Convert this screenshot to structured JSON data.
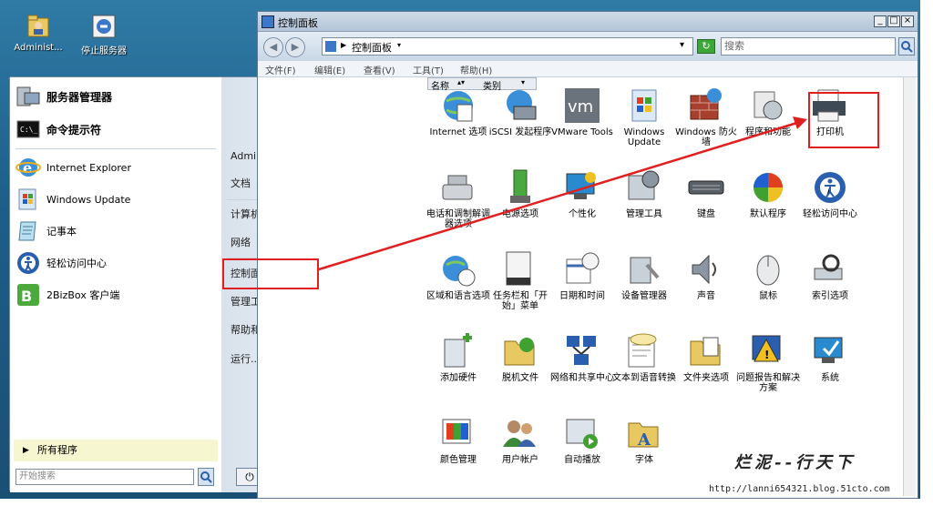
{
  "desktop": {
    "icons": [
      {
        "label": "Administ...",
        "icon": "user-folder-icon"
      },
      {
        "label": "停止服务器",
        "icon": "stop-server-icon"
      }
    ]
  },
  "start_menu": {
    "pinned": [
      {
        "label": "服务器管理器",
        "icon": "server-manager-icon",
        "bold": true
      },
      {
        "label": "命令提示符",
        "icon": "cmd-icon",
        "bold": true
      },
      {
        "label": "Internet Explorer",
        "icon": "ie-icon"
      },
      {
        "label": "Windows Update",
        "icon": "windows-update-icon"
      },
      {
        "label": "记事本",
        "icon": "notepad-icon"
      },
      {
        "label": "轻松访问中心",
        "icon": "ease-of-access-icon"
      },
      {
        "label": "2BizBox 客户端",
        "icon": "bizbox-icon"
      }
    ],
    "all_programs": "所有程序",
    "search_placeholder": "开始搜索",
    "right_items": [
      {
        "label": "Administrator"
      },
      {
        "label": "文档"
      },
      {
        "label": "计算机"
      },
      {
        "label": "网络"
      },
      {
        "label": "控制面板"
      },
      {
        "label": "管理工具"
      },
      {
        "label": "帮助和支持"
      },
      {
        "label": "运行..."
      }
    ]
  },
  "window": {
    "title": "控制面板",
    "address": "控制面板",
    "search_placeholder": "搜索",
    "menus": [
      "文件(F)",
      "编辑(E)",
      "查看(V)",
      "工具(T)",
      "帮助(H)"
    ],
    "columns": [
      "名称",
      "类别"
    ],
    "items": [
      {
        "label": "Internet 选项",
        "icon": "globe-options-icon"
      },
      {
        "label": "iSCSI 发起程序",
        "icon": "iscsi-icon"
      },
      {
        "label": "VMware Tools",
        "icon": "vmware-icon"
      },
      {
        "label": "Windows Update",
        "icon": "windows-update-icon"
      },
      {
        "label": "Windows 防火墙",
        "icon": "firewall-icon"
      },
      {
        "label": "程序和功能",
        "icon": "programs-icon"
      },
      {
        "label": "打印机",
        "icon": "printer-icon"
      },
      {
        "label": "电话和调制解调器选项",
        "icon": "phone-icon"
      },
      {
        "label": "电源选项",
        "icon": "power-icon"
      },
      {
        "label": "个性化",
        "icon": "personalize-icon"
      },
      {
        "label": "管理工具",
        "icon": "admin-tools-icon"
      },
      {
        "label": "键盘",
        "icon": "keyboard-icon"
      },
      {
        "label": "默认程序",
        "icon": "default-programs-icon"
      },
      {
        "label": "轻松访问中心",
        "icon": "ease-of-access-icon"
      },
      {
        "label": "区域和语言选项",
        "icon": "region-icon"
      },
      {
        "label": "任务栏和「开始」菜单",
        "icon": "taskbar-icon"
      },
      {
        "label": "日期和时间",
        "icon": "datetime-icon"
      },
      {
        "label": "设备管理器",
        "icon": "device-manager-icon"
      },
      {
        "label": "声音",
        "icon": "sound-icon"
      },
      {
        "label": "鼠标",
        "icon": "mouse-icon"
      },
      {
        "label": "索引选项",
        "icon": "index-icon"
      },
      {
        "label": "添加硬件",
        "icon": "add-hardware-icon"
      },
      {
        "label": "脱机文件",
        "icon": "offline-files-icon"
      },
      {
        "label": "网络和共享中心",
        "icon": "network-icon"
      },
      {
        "label": "文本到语音转换",
        "icon": "text-speech-icon"
      },
      {
        "label": "文件夹选项",
        "icon": "folder-options-icon"
      },
      {
        "label": "问题报告和解决方案",
        "icon": "problem-reports-icon"
      },
      {
        "label": "系统",
        "icon": "system-icon"
      },
      {
        "label": "颜色管理",
        "icon": "color-icon"
      },
      {
        "label": "用户帐户",
        "icon": "users-icon"
      },
      {
        "label": "自动播放",
        "icon": "autoplay-icon"
      },
      {
        "label": "字体",
        "icon": "fonts-icon"
      }
    ]
  },
  "watermark": {
    "text": "烂泥--行天下",
    "url": "http://lanni654321.blog.51cto.com"
  },
  "colors": {
    "highlight": "#e02020",
    "window_border": "#5f7993"
  }
}
